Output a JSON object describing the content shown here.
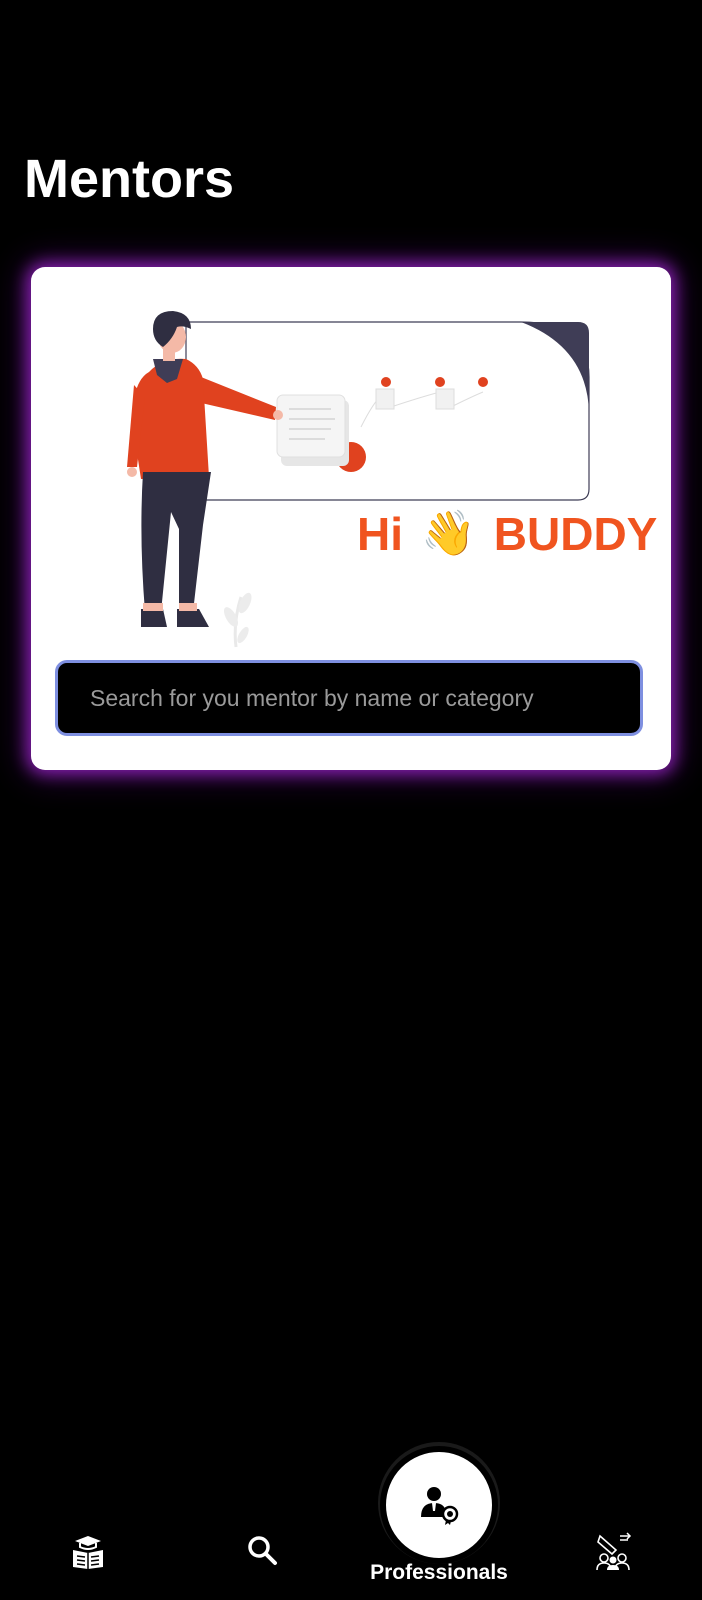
{
  "page": {
    "title": "Mentors"
  },
  "hero": {
    "greeting_hi": "Hi",
    "greeting_wave": "👋",
    "greeting_name": "BUDDY"
  },
  "search": {
    "placeholder": "Search for you mentor by name or category",
    "value": ""
  },
  "bottom_nav": {
    "items": [
      {
        "icon": "book-cap-icon",
        "label": ""
      },
      {
        "icon": "search-icon",
        "label": ""
      },
      {
        "icon": "mentor-badge-icon",
        "label": "Professionals",
        "active": true
      },
      {
        "icon": "community-icon",
        "label": ""
      }
    ]
  },
  "colors": {
    "background": "#000000",
    "accent_orange": "#f0541f",
    "card_glow": "#aa28dc",
    "search_border": "#7e8fe0"
  }
}
